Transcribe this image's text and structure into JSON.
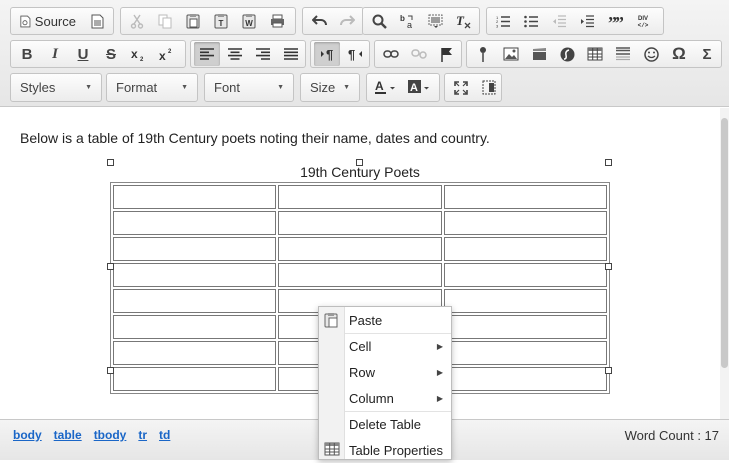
{
  "toolbar": {
    "source_label": "Source",
    "styles_label": "Styles",
    "format_label": "Format",
    "font_label": "Font",
    "size_label": "Size"
  },
  "editor": {
    "intro_text": "Below is a table of 19th Century poets noting their name, dates and country.",
    "table_caption": "19th Century Poets",
    "table_rows": 8,
    "table_cols": 3
  },
  "context_menu": {
    "items": [
      {
        "label": "Paste",
        "icon": "paste-icon",
        "submenu": false
      },
      {
        "label": "Cell",
        "submenu": true
      },
      {
        "label": "Row",
        "submenu": true
      },
      {
        "label": "Column",
        "submenu": true
      },
      {
        "label": "Delete Table",
        "submenu": false
      },
      {
        "label": "Table Properties",
        "icon": "table-icon",
        "submenu": false
      }
    ]
  },
  "statusbar": {
    "path": [
      "body",
      "table",
      "tbody",
      "tr",
      "td"
    ],
    "word_count": "Word Count : 17"
  },
  "colors": {
    "link": "#1a66c7",
    "active_button": "#cfcfcf"
  }
}
